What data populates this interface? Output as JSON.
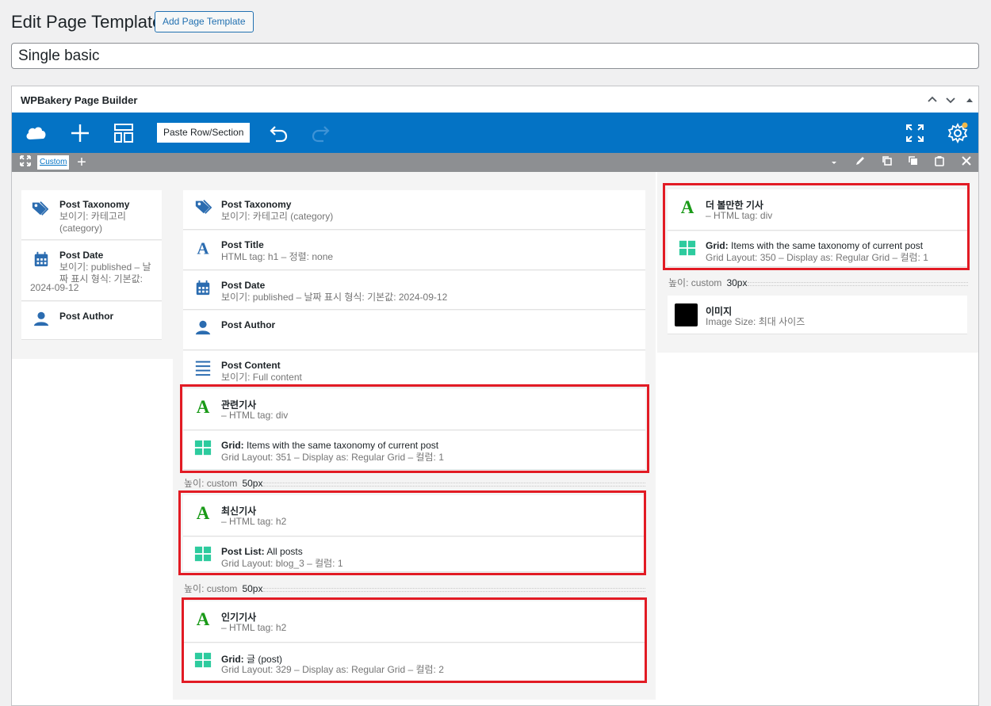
{
  "header": {
    "title": "Edit Page Template",
    "add_label": "Add Page Template"
  },
  "post_title": "Single basic",
  "builder": {
    "title": "WPBakery Page Builder",
    "paste_label": "Paste Row/Section",
    "tab_label": "Custom"
  },
  "left_col": [
    {
      "icon": "tag-icon",
      "name": "Post Taxonomy",
      "sub1": "보이기: 카테고리",
      "sub2": "(category)"
    },
    {
      "icon": "calendar-icon",
      "name": "Post Date",
      "sub1": "보이기: published – 날",
      "sub2": "짜 표시 형식: 기본값:",
      "sub3": "2024-09-12"
    },
    {
      "icon": "user-icon",
      "name": "Post Author"
    }
  ],
  "mid_col": [
    {
      "icon": "tag-icon",
      "name": "Post Taxonomy",
      "sub": "보이기: 카테고리 (category)"
    },
    {
      "icon": "text-icon",
      "name": "Post Title",
      "sub": "HTML tag: h1 – 정렬: none"
    },
    {
      "icon": "calendar-icon",
      "name": "Post Date",
      "sub": "보이기: published – 날짜 표시 형식: 기본값: 2024-09-12"
    },
    {
      "icon": "user-icon",
      "name": "Post Author",
      "sub": ""
    },
    {
      "icon": "lines-icon",
      "name": "Post Content",
      "sub": "보이기: Full content"
    },
    {
      "icon": "heading-icon",
      "name": "관련기사",
      "sub": "– HTML tag: div"
    },
    {
      "icon": "grid-icon",
      "name": "Grid:",
      "rest": " Items with the same taxonomy of current post",
      "sub": "Grid Layout: 351 – Display as: Regular Grid – 컬럼: 1"
    },
    {
      "icon": "heading-icon",
      "name": "최신기사",
      "sub": "– HTML tag: h2"
    },
    {
      "icon": "grid-icon",
      "name": "Post List:",
      "rest": " All posts",
      "sub": "Grid Layout: blog_3 – 컬럼: 1"
    },
    {
      "icon": "heading-icon",
      "name": "인기기사",
      "sub": "– HTML tag: h2"
    },
    {
      "icon": "grid-icon",
      "name": "Grid:",
      "rest": " 글 (post)",
      "sub": "Grid Layout: 329 – Display as: Regular Grid – 컬럼: 2"
    }
  ],
  "mid_seps": [
    {
      "label": "높이: custom",
      "value": "50px"
    },
    {
      "label": "높이: custom",
      "value": "50px"
    }
  ],
  "right_col": [
    {
      "icon": "heading-icon",
      "name": "더 볼만한 기사",
      "sub": "– HTML tag: div"
    },
    {
      "icon": "grid-icon",
      "name": "Grid:",
      "rest": " Items with the same taxonomy of current post",
      "sub": "Grid Layout: 350 – Display as: Regular Grid – 컬럼: 1"
    },
    {
      "icon": "image-thumb",
      "name": "이미지",
      "sub": "Image Size: 최대 사이즈"
    }
  ],
  "right_sep": {
    "label": "높이: custom",
    "value": "30px"
  },
  "colors": {
    "toolbar": "#0473c5",
    "rowbar": "#8d8f92",
    "highlight": "#e21b24",
    "heading_icon": "#1a9a18",
    "grid_icon": "#2dcb9e",
    "wp_icon": "#2b6cb0"
  }
}
